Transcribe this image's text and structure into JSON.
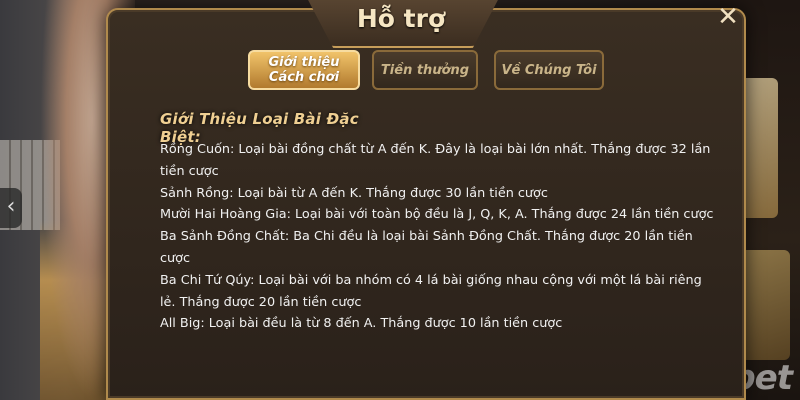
{
  "modal": {
    "title": "Hỗ trợ",
    "close_icon": "close-icon"
  },
  "tabs": [
    {
      "label": "Giới thiệu\nCách chơi",
      "active": true
    },
    {
      "label": "Tiền thưởng",
      "active": false
    },
    {
      "label": "Về Chúng Tôi",
      "active": false
    }
  ],
  "section": {
    "heading": "Giới Thiệu Loại Bài Đặc Biệt:",
    "items": [
      "Rồng Cuốn: Loại bài đồng chất từ A đến K. Đây là loại bài lớn nhất. Thắng được 32 lần tiền cược",
      "Sảnh Rồng: Loại bài từ A đến K. Thắng được 30 lần tiền cược",
      "Mười Hai Hoàng Gia: Loại bài với toàn bộ đều là J, Q, K, A. Thắng được 24 lần tiền cược",
      "Ba Sảnh Đồng Chất: Ba Chi đều là loại bài Sảnh Đồng Chất. Thắng được 20 lần tiền cược",
      "Ba Chi Tứ Qúy: Loại bài với ba nhóm có 4 lá bài giống nhau cộng với một lá bài riêng lẻ. Thắng được 20 lần tiền cược",
      "All Big: Loại bài đều là từ 8 đến A. Thắng được 10 lần tiền cược"
    ]
  },
  "background": {
    "brand": "bet",
    "left_arrow_icon": "chevron-left-icon"
  },
  "colors": {
    "accent_gold": "#f1c36a",
    "panel_bg": "#2a211a",
    "heading_text": "#efcf92",
    "body_text": "#f1f1f1"
  }
}
